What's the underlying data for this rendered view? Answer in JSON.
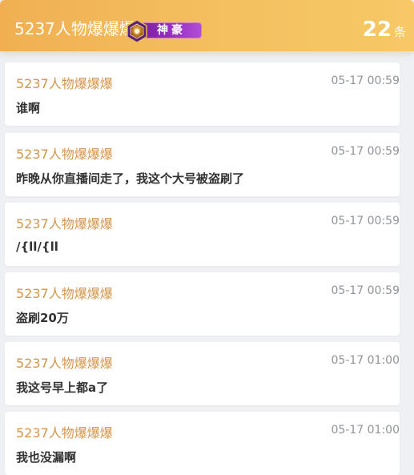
{
  "header": {
    "name": "5237人物爆爆爆",
    "badge_label": "神豪",
    "count": "22",
    "count_unit": "条"
  },
  "colors": {
    "header_gradient_start": "#f0b052",
    "header_gradient_end": "#f6c866",
    "badge_purple": "#9a33c6",
    "sender_gold": "#d4954a",
    "time_gray": "#8f939b",
    "text_dark": "#333333",
    "background": "#eef0f3"
  },
  "messages": [
    {
      "sender": "5237人物爆爆爆",
      "time": "05-17 00:59",
      "text": "谁啊"
    },
    {
      "sender": "5237人物爆爆爆",
      "time": "05-17 00:59",
      "text": "昨晚从你直播间走了，我这个大号被盗刷了"
    },
    {
      "sender": "5237人物爆爆爆",
      "time": "05-17 00:59",
      "text": "/{ll/{ll"
    },
    {
      "sender": "5237人物爆爆爆",
      "time": "05-17 00:59",
      "text": "盗刷20万"
    },
    {
      "sender": "5237人物爆爆爆",
      "time": "05-17 01:00",
      "text": "我这号早上都a了"
    },
    {
      "sender": "5237人物爆爆爆",
      "time": "05-17 01:00",
      "text": "我也没漏啊"
    }
  ]
}
